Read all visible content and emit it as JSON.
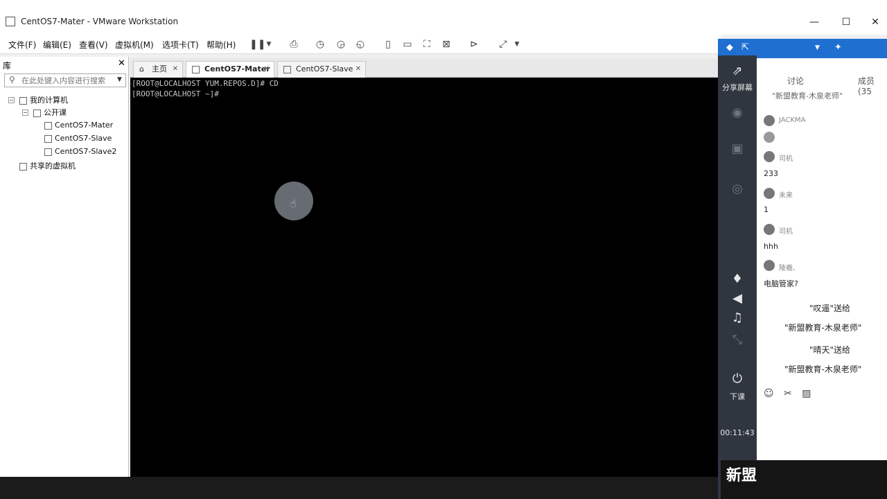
{
  "window": {
    "title": "CentOS7-Mater - VMware Workstation",
    "minimize": "—",
    "maximize": "☐",
    "close": "✕"
  },
  "menu": [
    "文件(F)",
    "编辑(E)",
    "查看(V)",
    "虚拟机(M)",
    "选项卡(T)",
    "帮助(H)"
  ],
  "library": {
    "header": "库",
    "close": "✕",
    "search_placeholder": "在此处键入内容进行搜索",
    "tree": {
      "my_computer": "我的计算机",
      "folder": "公开课",
      "vms": [
        "CentOS7-Mater",
        "CentOS7-Slave",
        "CentOS7-Slave2"
      ],
      "shared": "共享的虚拟机"
    }
  },
  "tabs": [
    {
      "label": "主页",
      "close": "✕"
    },
    {
      "label": "CentOS7-Mater",
      "close": "✕"
    },
    {
      "label": "CentOS7-Slave",
      "close": "✕"
    }
  ],
  "console": {
    "lines": [
      "[ROOT@LOCALHOST YUM.REPOS.D]# CD",
      "[ROOT@LOCALHOST ~]#"
    ]
  },
  "overlay": {
    "share_screen": "分享屏幕",
    "end_class": "下课",
    "timer": "00:11:43",
    "brand": "新盟"
  },
  "chat": {
    "tabs": {
      "discussion": "讨论",
      "members": "成员(35"
    },
    "header_text": "\"新盟教育-木泉老师\"",
    "messages": [
      {
        "name": "JACKMA",
        "text": ""
      },
      {
        "name": "司机",
        "text": "233"
      },
      {
        "name": "未来",
        "text": "1"
      },
      {
        "name": "司机",
        "text": "hhh"
      },
      {
        "name": "陵羲、",
        "text": "电脑管家?"
      }
    ],
    "gifts": [
      {
        "line1": "\"叹遥\"送给",
        "line2": "\"新盟教育-木泉老师\""
      },
      {
        "line1": "\"晴天\"送给",
        "line2": "\"新盟教育-木泉老师\""
      }
    ]
  }
}
